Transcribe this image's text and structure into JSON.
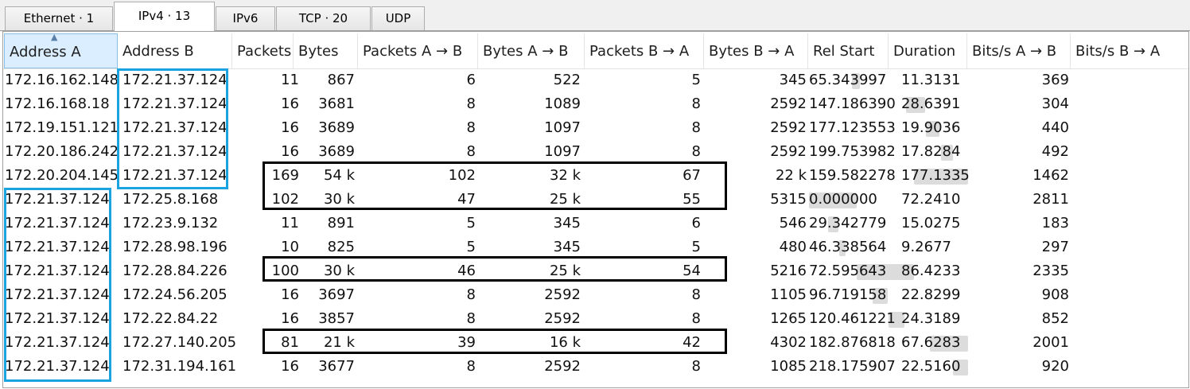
{
  "tabs": [
    {
      "label": "Ethernet · 1",
      "active": false
    },
    {
      "label": "IPv4 · 13",
      "active": true
    },
    {
      "label": "IPv6",
      "active": false
    },
    {
      "label": "TCP · 20",
      "active": false
    },
    {
      "label": "UDP",
      "active": false
    }
  ],
  "columns": [
    "Address A",
    "Address B",
    "Packets",
    "Bytes",
    "Packets A → B",
    "Bytes A → B",
    "Packets B → A",
    "Bytes B → A",
    "Rel Start",
    "Duration",
    "Bits/s A → B",
    "Bits/s B → A"
  ],
  "sorted_column": "Address A",
  "rows": [
    [
      "172.16.162.148",
      "172.21.37.124",
      "11",
      "867",
      "6",
      "522",
      "5",
      "345",
      "65.343997",
      "11.3131",
      "369",
      ""
    ],
    [
      "172.16.168.18",
      "172.21.37.124",
      "16",
      "3681",
      "8",
      "1089",
      "8",
      "2592",
      "147.186390",
      "28.6391",
      "304",
      ""
    ],
    [
      "172.19.151.121",
      "172.21.37.124",
      "16",
      "3689",
      "8",
      "1097",
      "8",
      "2592",
      "177.123553",
      "19.9036",
      "440",
      ""
    ],
    [
      "172.20.186.242",
      "172.21.37.124",
      "16",
      "3689",
      "8",
      "1097",
      "8",
      "2592",
      "199.753982",
      "17.8284",
      "492",
      ""
    ],
    [
      "172.20.204.145",
      "172.21.37.124",
      "169",
      "54 k",
      "102",
      "32 k",
      "67",
      "22 k",
      "159.582278",
      "177.1335",
      "1462",
      ""
    ],
    [
      "172.21.37.124",
      "172.25.8.168",
      "102",
      "30 k",
      "47",
      "25 k",
      "55",
      "5315",
      "0.000000",
      "72.2410",
      "2811",
      ""
    ],
    [
      "172.21.37.124",
      "172.23.9.132",
      "11",
      "891",
      "5",
      "345",
      "6",
      "546",
      "29.342779",
      "15.0275",
      "183",
      ""
    ],
    [
      "172.21.37.124",
      "172.28.98.196",
      "10",
      "825",
      "5",
      "345",
      "5",
      "480",
      "46.338564",
      "9.2677",
      "297",
      ""
    ],
    [
      "172.21.37.124",
      "172.28.84.226",
      "100",
      "30 k",
      "46",
      "25 k",
      "54",
      "5216",
      "72.595643",
      "86.4233",
      "2335",
      ""
    ],
    [
      "172.21.37.124",
      "172.24.56.205",
      "16",
      "3697",
      "8",
      "2592",
      "8",
      "1105",
      "96.719158",
      "22.8299",
      "908",
      ""
    ],
    [
      "172.21.37.124",
      "172.22.84.22",
      "16",
      "3857",
      "8",
      "2592",
      "8",
      "1265",
      "120.461221",
      "24.3189",
      "852",
      ""
    ],
    [
      "172.21.37.124",
      "172.27.140.205",
      "81",
      "21 k",
      "39",
      "16 k",
      "42",
      "4302",
      "182.876818",
      "67.6283",
      "2001",
      ""
    ],
    [
      "172.21.37.124",
      "172.31.194.161",
      "16",
      "3677",
      "8",
      "2592",
      "8",
      "1085",
      "218.175907",
      "22.5160",
      "920",
      ""
    ]
  ],
  "timeline": {
    "capture_span": 241,
    "rows": [
      {
        "start": 65.343997,
        "duration": 11.3131
      },
      {
        "start": 147.18639,
        "duration": 28.6391
      },
      {
        "start": 177.123553,
        "duration": 19.9036
      },
      {
        "start": 199.753982,
        "duration": 17.8284
      },
      {
        "start": 159.582278,
        "duration": 177.1335
      },
      {
        "start": 0.0,
        "duration": 72.241
      },
      {
        "start": 29.342779,
        "duration": 15.0275
      },
      {
        "start": 46.338564,
        "duration": 9.2677
      },
      {
        "start": 72.595643,
        "duration": 86.4233
      },
      {
        "start": 96.719158,
        "duration": 22.8299
      },
      {
        "start": 120.461221,
        "duration": 24.3189
      },
      {
        "start": 182.876818,
        "duration": 67.6283
      },
      {
        "start": 218.175907,
        "duration": 22.516
      }
    ]
  },
  "highlight_colors": {
    "address": "#1aa3e0",
    "rows": "#000000"
  },
  "accent": {
    "sorted_header_bg": "#daeeff",
    "timeline_bar": "#dcdcdc"
  }
}
